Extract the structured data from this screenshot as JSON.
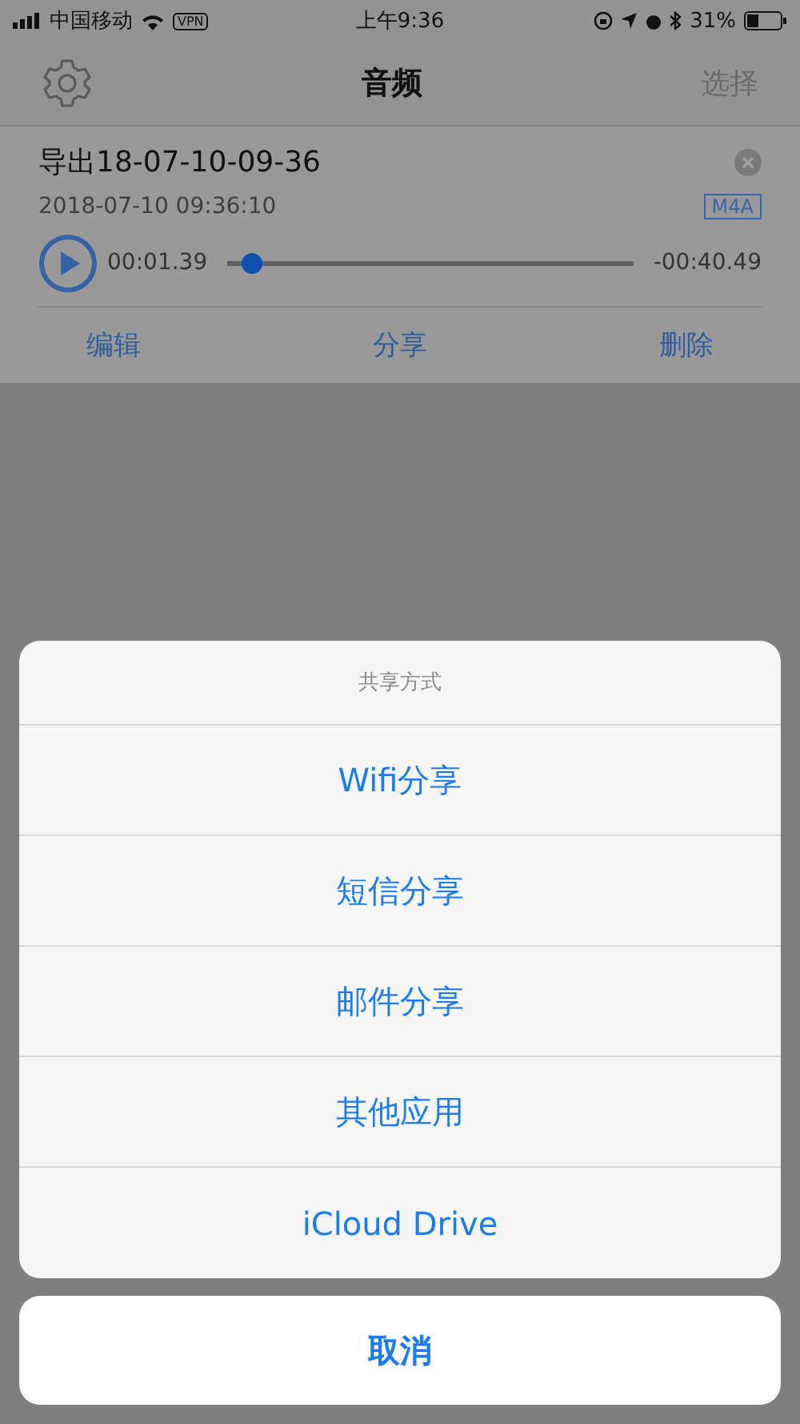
{
  "status_bar": {
    "carrier": "中国移动",
    "vpn": "VPN",
    "time": "上午9:36",
    "battery": "31%"
  },
  "nav": {
    "title": "音频",
    "action": "选择"
  },
  "recording": {
    "name": "导出18-07-10-09-36",
    "date": "2018-07-10 09:36:10",
    "format": "M4A",
    "elapsed": "00:01.39",
    "remaining": "-00:40.49",
    "level": 0.04,
    "actions": [
      "编辑",
      "分享",
      "删除"
    ]
  },
  "sheet": {
    "title": "共享方式",
    "options": [
      "Wifi分享",
      "短信分享",
      "邮件分享",
      "其他应用",
      "iCloud Drive"
    ],
    "cancel": "取消"
  }
}
